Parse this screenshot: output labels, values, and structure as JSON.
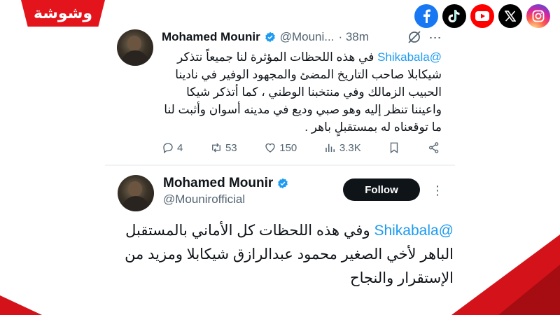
{
  "brand": {
    "logo_text": "وشوشة",
    "accent": "#e3141c"
  },
  "social_icons": [
    {
      "name": "facebook-icon",
      "color": "#1877f2"
    },
    {
      "name": "tiktok-icon",
      "color": "#000000"
    },
    {
      "name": "youtube-icon",
      "color": "#ff0000"
    },
    {
      "name": "x-icon",
      "color": "#000000"
    },
    {
      "name": "instagram-icon",
      "color": "#e1306c"
    }
  ],
  "tweet1": {
    "name": "Mohamed Mounir",
    "handle": "@Mouni...",
    "time": "· 38m",
    "mention": "@Shikabala",
    "text": " في هذه اللحظات المؤثرة لنا جميعاً نتذكر شيكابلا صاحب التاريخ المضئ والمجهود الوفير في نادينا الحبيب الزمالك وفي منتخبنا الوطني ، كما أتذكر شيكا واعيننا تنظر إليه وهو صبي وديع في مدينه أسوان وأثبت لنا ما توقعناه له بمستقبلٍ باهر .",
    "replies": "4",
    "retweets": "53",
    "likes": "150",
    "views": "3.3K"
  },
  "tweet2": {
    "name": "Mohamed Mounir",
    "handle": "@Mounirofficial",
    "follow_label": "Follow",
    "mention": "@Shikabala",
    "text": " وفي هذه اللحظات كل الأماني بالمستقبل الباهر لأخي الصغير محمود عبدالرازق شيكابلا ومزيد من الإستقرار والنجاح"
  }
}
